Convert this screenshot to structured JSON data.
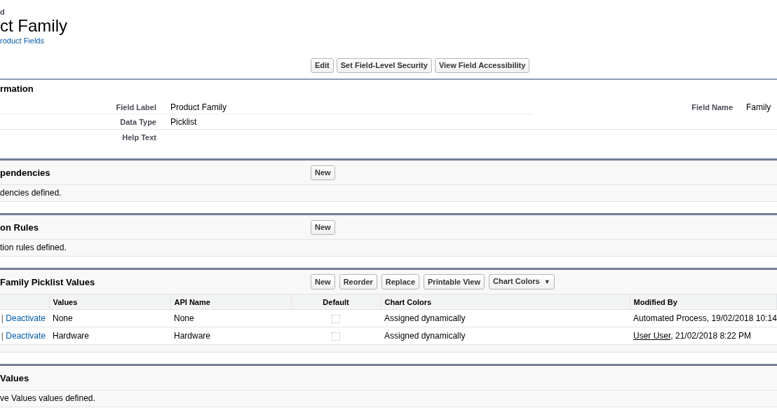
{
  "header": {
    "breadcrumb": "d",
    "title": "ct Family",
    "back_link": "roduct Fields"
  },
  "top_buttons": [
    "Edit",
    "Set Field-Level Security",
    "View Field Accessibility"
  ],
  "info_section": {
    "title": "rmation",
    "rows": [
      {
        "label": "Field Label",
        "value": "Product Family",
        "right_label": "Field Name",
        "right_value": "Family"
      },
      {
        "label": "Data Type",
        "value": "Picklist"
      },
      {
        "label": "Help Text"
      }
    ]
  },
  "sections": [
    {
      "kind": "message",
      "title": "pendencies",
      "buttons": [
        {
          "label": "New"
        }
      ],
      "message": "dencies defined."
    },
    {
      "kind": "message",
      "title": "on Rules",
      "buttons": [
        {
          "label": "New"
        }
      ],
      "message": "tion rules defined."
    },
    {
      "kind": "table",
      "title": "Family Picklist Values",
      "buttons": [
        {
          "label": "New"
        },
        {
          "label": "Reorder"
        },
        {
          "label": "Replace"
        },
        {
          "label": "Printable View"
        },
        {
          "label": "Chart Colors",
          "caret": "▼"
        }
      ],
      "table": {
        "columns": [
          "Values",
          "API Name",
          "Default",
          "Chart Colors",
          "Modified By"
        ],
        "rows": [
          {
            "separator": "|",
            "action": "Deactivate",
            "value": "None",
            "api_name": "None",
            "default": false,
            "chart_color": "Assigned dynamically",
            "modified_user": "Automated Process",
            "user_link": false,
            "modified_rest": ", 19/02/2018 10:14"
          },
          {
            "separator": "|",
            "action": "Deactivate",
            "value": "Hardware",
            "api_name": "Hardware",
            "default": false,
            "chart_color": "Assigned dynamically",
            "modified_user": "User User",
            "user_link": true,
            "modified_rest": ", 21/02/2018 8:22 PM"
          }
        ]
      }
    },
    {
      "kind": "message",
      "title": "Values",
      "message": "ve Values values defined."
    }
  ]
}
